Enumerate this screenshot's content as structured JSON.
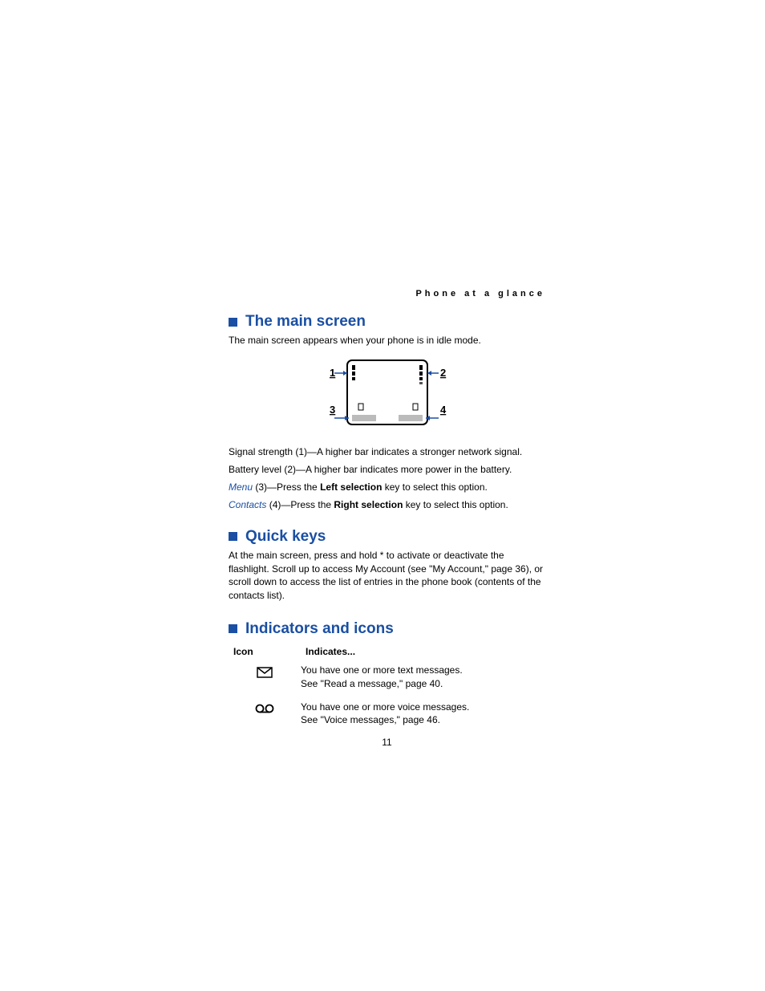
{
  "header": "Phone at a glance",
  "sections": {
    "main_screen": {
      "title": "The main screen",
      "intro": "The main screen appears when your phone is in idle mode.",
      "callouts": {
        "n1": "1",
        "n2": "2",
        "n3": "3",
        "n4": "4"
      },
      "lines": {
        "l1": "Signal strength (1)—A higher bar indicates a stronger network signal.",
        "l2": "Battery level (2)—A higher bar indicates more power in the battery.",
        "l3_link": "Menu",
        "l3_mid": " (3)—Press the ",
        "l3_bold": "Left selection",
        "l3_end": " key to select this option.",
        "l4_link": "Contacts",
        "l4_mid": " (4)—Press the ",
        "l4_bold": "Right selection",
        "l4_end": " key to select this option."
      }
    },
    "quick_keys": {
      "title": "Quick keys",
      "text": "At the main screen, press and hold * to activate or deactivate the flashlight. Scroll up to access My Account (see \"My Account,\" page 36), or scroll down to access the list of entries in the phone book (contents of the contacts list)."
    },
    "indicators": {
      "title": "Indicators and icons",
      "headers": {
        "icon": "Icon",
        "indicates": "Indicates..."
      },
      "rows": [
        {
          "icon_name": "envelope-icon",
          "line1": "You have one or more text messages.",
          "line2": "See \"Read a message,\" page 40."
        },
        {
          "icon_name": "voicemail-icon",
          "line1": "You have one or more voice messages.",
          "line2": "See \"Voice messages,\" page 46."
        }
      ]
    }
  },
  "page_number": "11"
}
